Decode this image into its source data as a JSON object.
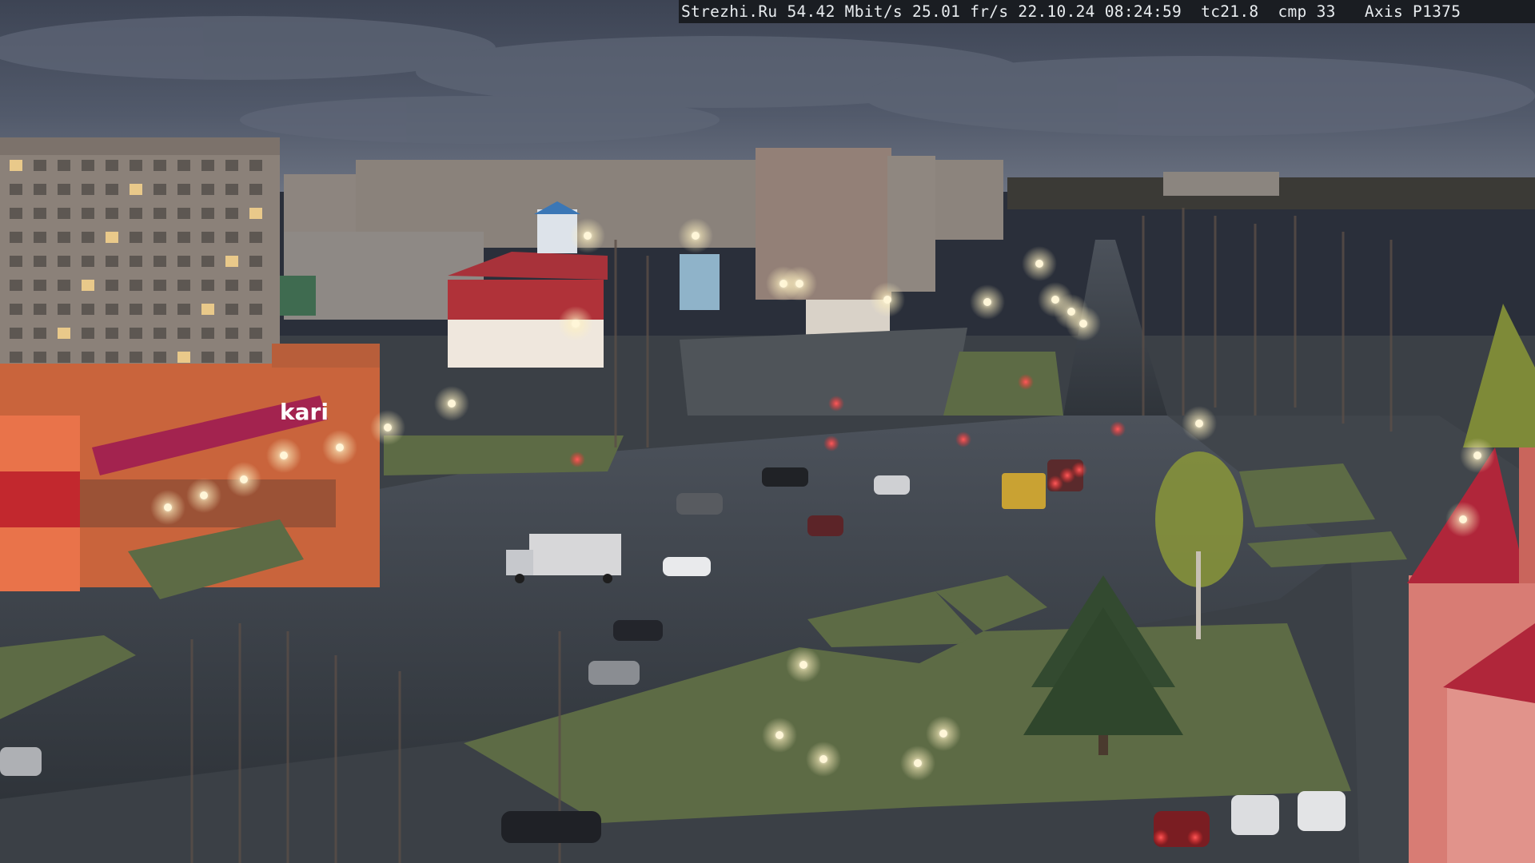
{
  "camera_overlay": {
    "text": "Strezhi.Ru 54.42 Mbit/s 25.01 fr/s 22.10.24 08:24:59  tc21.8  cmp 33   Axis P1375"
  },
  "signage": {
    "store_sign": "kari"
  },
  "colors": {
    "sky": "#4a5262",
    "cloud": "#5c6474",
    "asphalt_wet": "#3c4148",
    "grass": "#5d6b45",
    "panel_building": "#8b8179",
    "orange_building": "#c9643c",
    "magenta_sign": "#a3234f",
    "red_roof": "#b0263a",
    "streetlight": "#fff6d8",
    "brake_light": "#ff3a3a"
  }
}
